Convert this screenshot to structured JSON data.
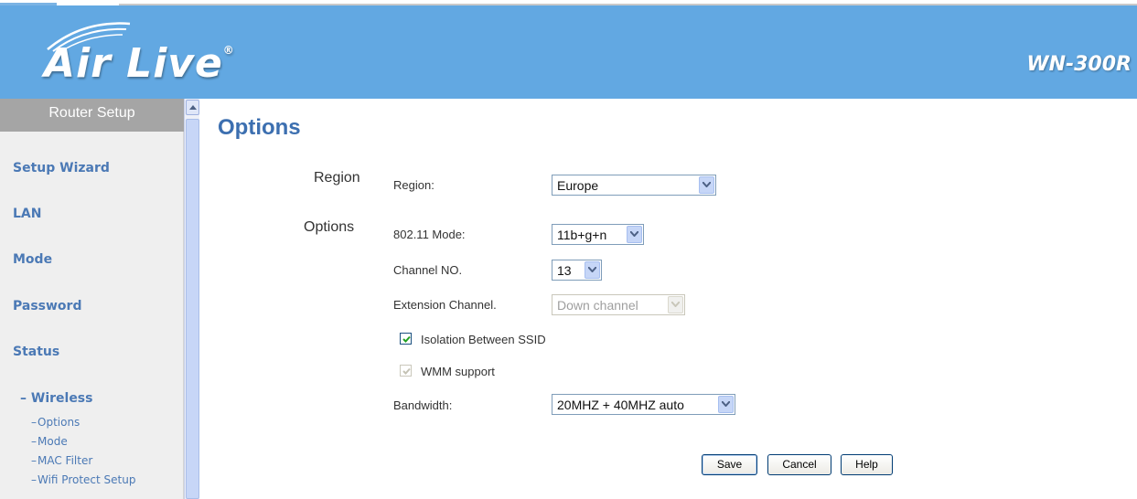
{
  "header": {
    "logo_text": "Air Live",
    "logo_registered": "®",
    "model": "WN-300R"
  },
  "sidebar": {
    "heading": "Router Setup",
    "items": [
      {
        "label": "Setup Wizard"
      },
      {
        "label": "LAN"
      },
      {
        "label": "Mode"
      },
      {
        "label": "Password"
      },
      {
        "label": "Status"
      }
    ],
    "open_section": "Wireless",
    "open_marker": "–",
    "sub_items": [
      {
        "label": "Options"
      },
      {
        "label": "Mode"
      },
      {
        "label": "MAC Filter"
      },
      {
        "label": "Wifi Protect Setup"
      }
    ]
  },
  "page": {
    "title": "Options",
    "sections": {
      "region": "Region",
      "options": "Options"
    },
    "fields": {
      "region": {
        "label": "Region:",
        "value": "Europe"
      },
      "mode": {
        "label": "802.11 Mode:",
        "value": "11b+g+n"
      },
      "channel": {
        "label": "Channel NO.",
        "value": "13"
      },
      "extension": {
        "label": "Extension Channel.",
        "value": "Down channel"
      },
      "isolation": {
        "label": "Isolation Between SSID",
        "checked": true
      },
      "wmm": {
        "label": "WMM support",
        "checked": true,
        "disabled": true
      },
      "bandwidth": {
        "label": "Bandwidth:",
        "value": "20MHZ + 40MHZ auto"
      }
    },
    "buttons": {
      "save": "Save",
      "cancel": "Cancel",
      "help": "Help"
    }
  },
  "colors": {
    "header_bg": "#62a8e2",
    "title": "#3c6fb0",
    "nav_link": "#4b79b5",
    "sidebar_head_bg": "#a5a5a5"
  }
}
